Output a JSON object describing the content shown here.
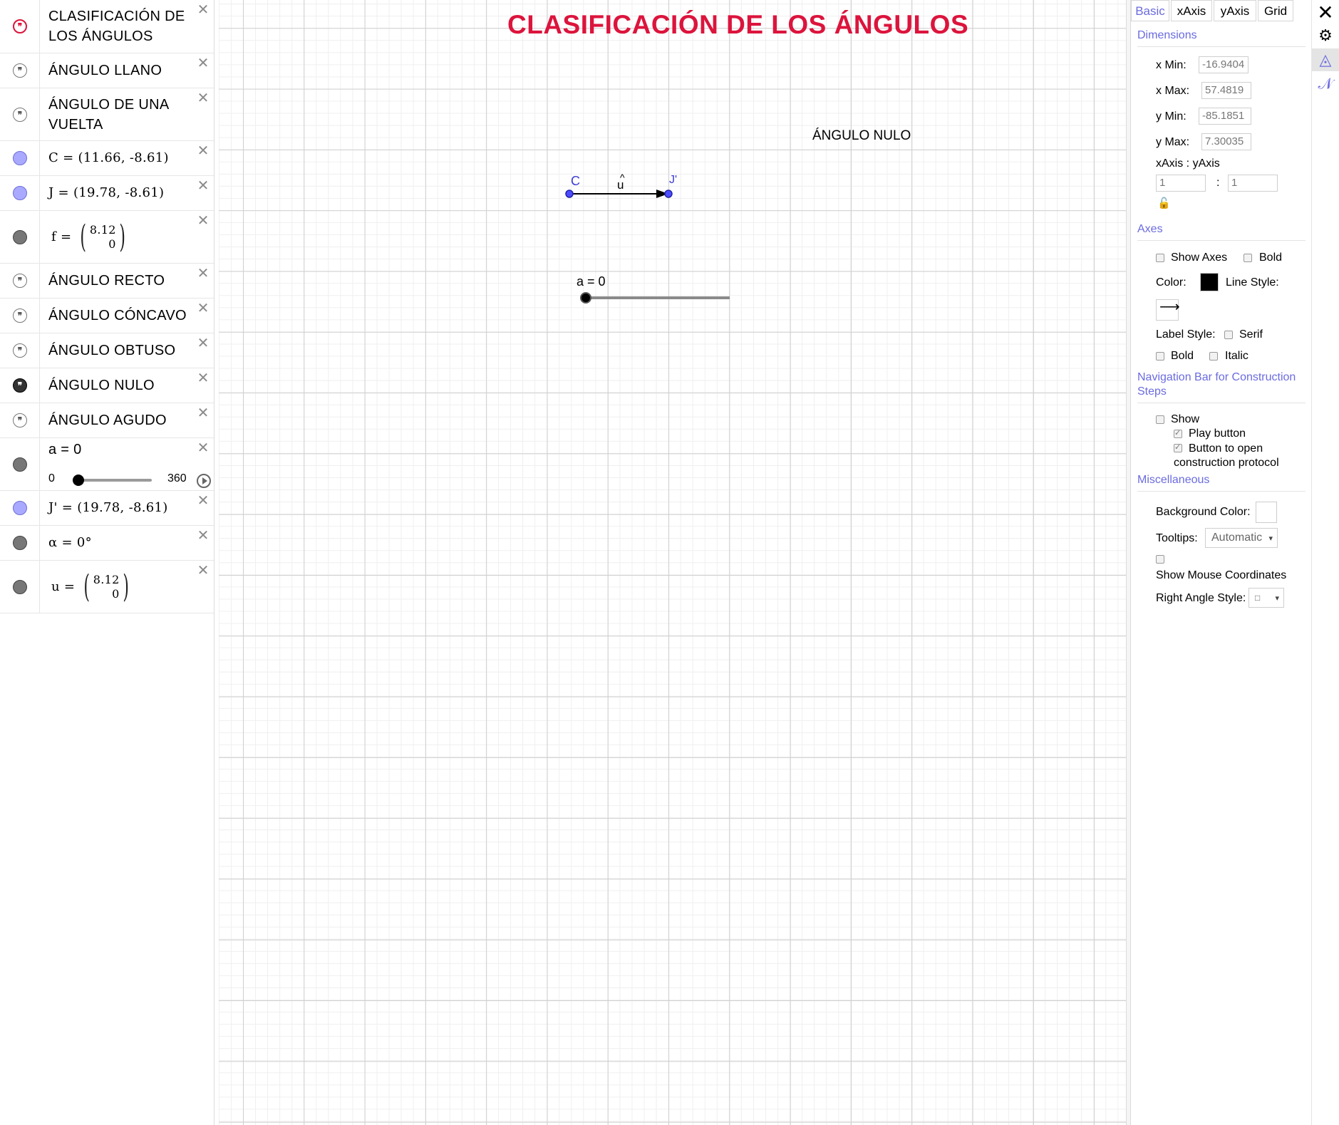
{
  "algebra": {
    "items": [
      {
        "text": "CLASIFICACIÓN DE LOS ÁNGULOS",
        "type": "text-red"
      },
      {
        "text": "ÁNGULO LLANO",
        "type": "text"
      },
      {
        "text": "ÁNGULO DE UNA VUELTA",
        "type": "text"
      },
      {
        "text": "C = (11.66, -8.61)",
        "type": "point"
      },
      {
        "text": "J = (19.78, -8.61)",
        "type": "point"
      },
      {
        "name": "f =",
        "vec_top": "8.12",
        "vec_bottom": "0",
        "type": "vector"
      },
      {
        "text": "ÁNGULO RECTO",
        "type": "text"
      },
      {
        "text": "ÁNGULO CÓNCAVO",
        "type": "text"
      },
      {
        "text": "ÁNGULO OBTUSO",
        "type": "text"
      },
      {
        "text": "ÁNGULO NULO",
        "type": "text-dark"
      },
      {
        "text": "ÁNGULO AGUDO",
        "type": "text"
      },
      {
        "text": "a = 0",
        "min": "0",
        "max": "360",
        "value": 0,
        "type": "slider"
      },
      {
        "text": "J' = (19.78, -8.61)",
        "type": "point"
      },
      {
        "text": "α = 0°",
        "type": "gray"
      },
      {
        "name": "u =",
        "vec_top": "8.12",
        "vec_bottom": "0",
        "type": "vector"
      }
    ],
    "quote_glyph": "❞",
    "close_glyph": "✕"
  },
  "graphics": {
    "title": "CLASIFICACIÓN DE LOS ÁNGULOS",
    "title_color": "#dc143c",
    "nulo_label": "ÁNGULO NULO",
    "point_c_label": "C",
    "point_jp_label": "J'",
    "vector_label": "u",
    "slider_label": "a = 0",
    "point_color": "#3b3bd6",
    "slider_value": 0
  },
  "props": {
    "tabs": [
      "Basic",
      "xAxis",
      "yAxis",
      "Grid"
    ],
    "active_tab": "Basic",
    "accent": "#6b6be0",
    "dimensions": {
      "title": "Dimensions",
      "xmin_label": "x Min:",
      "xmin": "-16.9404",
      "xmax_label": "x Max:",
      "xmax": "57.4819",
      "ymin_label": "y Min:",
      "ymin": "-85.1851",
      "ymax_label": "y Max:",
      "ymax": "7.30035",
      "ratio_label": "xAxis : yAxis",
      "ratio_x": "1",
      "ratio_sep": ":",
      "ratio_y": "1",
      "lock_icon": "🔓"
    },
    "axes": {
      "title": "Axes",
      "show_axes": "Show Axes",
      "bold": "Bold",
      "color_label": "Color:",
      "color": "#000000",
      "line_style_label": "Line Style:",
      "line_style_glyph": "⟶",
      "label_style_label": "Label Style:",
      "serif": "Serif",
      "bold2": "Bold",
      "italic": "Italic"
    },
    "navbar": {
      "title": "Navigation Bar for Construction Steps",
      "show": "Show",
      "play_button": "Play button",
      "protocol_button": "Button to open construction protocol"
    },
    "misc": {
      "title": "Miscellaneous",
      "bg_color_label": "Background Color:",
      "bg_color": "#ffffff",
      "tooltips_label": "Tooltips:",
      "tooltips_value": "Automatic",
      "mouse_coords": "Show Mouse Coordinates",
      "right_angle_label": "Right Angle Style:",
      "right_angle_value": "□",
      "dropdown_arrow": "▾"
    }
  },
  "strip": {
    "close_glyph": "✕",
    "gear_glyph": "⚙",
    "graphics_glyph": "◬",
    "algebra_glyph": "𝒩"
  }
}
